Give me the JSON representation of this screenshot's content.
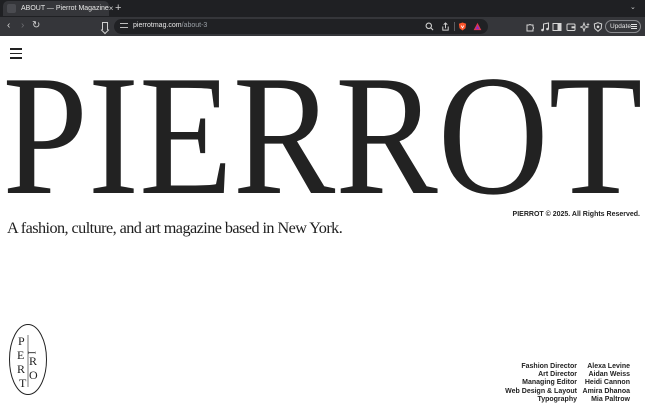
{
  "browser": {
    "tab": {
      "title": "ABOUT — Pierrot Magazine",
      "close": "×"
    },
    "new_tab": "+",
    "tabs_menu": "⌄",
    "nav": {
      "back": "‹",
      "forward": "›",
      "reload": "↻"
    },
    "address": {
      "host": "pierrotmag.com",
      "path": "/about-3"
    },
    "update_label": "Update"
  },
  "page": {
    "wordmark": "PIERROT",
    "copyright": "PIERROT © 2025. All Rights Reserved.",
    "tagline": "A fashion, culture, and art magazine based in New York.",
    "emblem_text": "PIERROT",
    "credits": [
      {
        "role": "Fashion Director",
        "name": "Alexa Levine"
      },
      {
        "role": "Art Director",
        "name": "Aidan Weiss"
      },
      {
        "role": "Managing Editor",
        "name": "Heidi Cannon"
      },
      {
        "role": "Web Design & Layout",
        "name": "Amira Dhanoa"
      },
      {
        "role": "Typography",
        "name": "Mia Paltrow"
      }
    ]
  },
  "colors": {
    "chrome_dark": "#1f2023",
    "chrome_toolbar": "#35363a",
    "ink": "#222222",
    "brave_orange": "#fb542b"
  },
  "icons": [
    "menu-icon",
    "bookmark-icon",
    "zoom-icon",
    "share-icon",
    "brave-shield-icon",
    "brave-rewards-icon",
    "extensions-icon",
    "media-icon",
    "sidebar-icon",
    "wallet-icon",
    "leo-ai-icon",
    "vpn-icon"
  ]
}
